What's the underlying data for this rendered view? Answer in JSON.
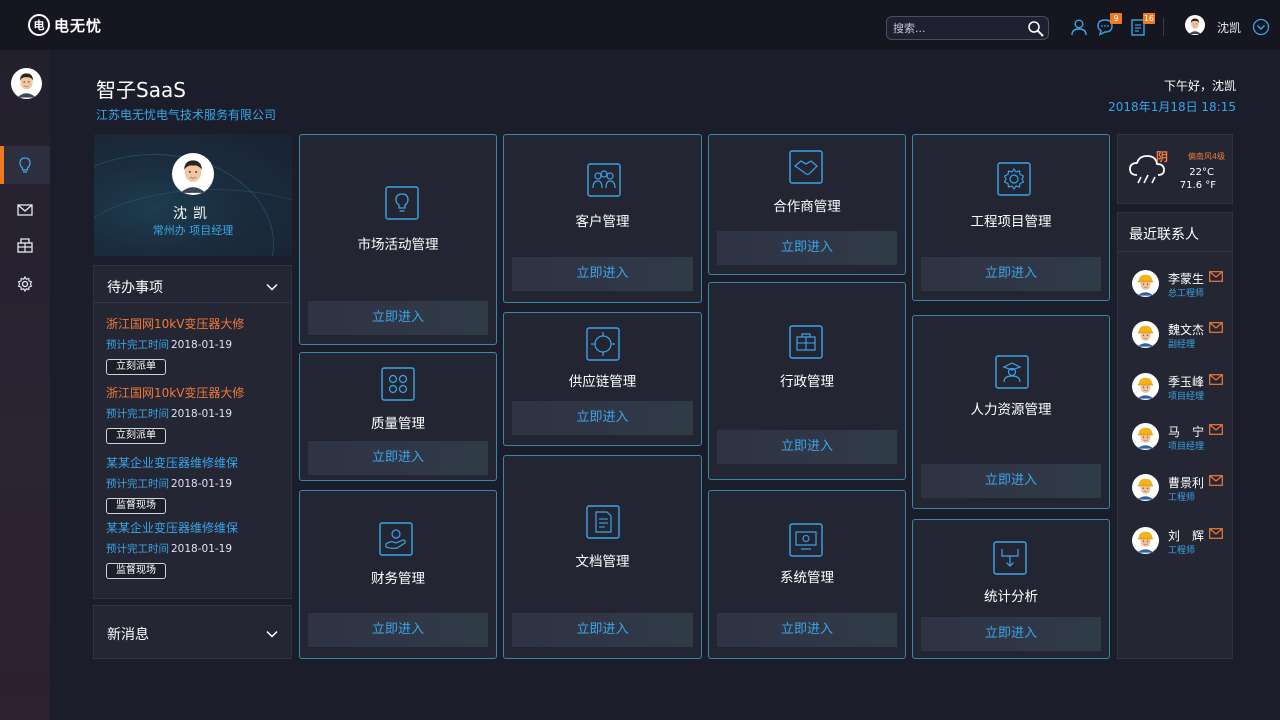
{
  "topbar": {
    "logo_text": "电无忧",
    "search_placeholder": "搜索...",
    "messages_badge": "9",
    "tasks_badge": "16",
    "user_name": "沈凯"
  },
  "header": {
    "title": "智子SaaS",
    "company": "江苏电无忧电气技术服务有限公司",
    "greeting": "下午好，沈凯",
    "datetime": "2018年1月18日 18:15"
  },
  "profile": {
    "name": "沈凯",
    "role": "常州办 项目经理"
  },
  "todo": {
    "title": "待办事项",
    "items": [
      {
        "title": "浙江国网10kV变压器大修",
        "meta_label": "预计完工时间",
        "date": "2018-01-19",
        "action": "立刻派单"
      },
      {
        "title": "浙江国网10kV变压器大修",
        "meta_label": "预计完工时间",
        "date": "2018-01-19",
        "action": "立刻派单"
      },
      {
        "title": "某某企业变压器维修维保",
        "meta_label": "预计完工时间",
        "date": "2018-01-19",
        "action": "监督现场"
      },
      {
        "title": "某某企业变压器维修维保",
        "meta_label": "预计完工时间",
        "date": "2018-01-19",
        "action": "监督现场"
      }
    ]
  },
  "news": {
    "title": "新消息"
  },
  "modules": {
    "enter_label": "立即进入",
    "market": "市场活动管理",
    "quality": "质量管理",
    "finance": "财务管理",
    "customer": "客户管理",
    "supply": "供应链管理",
    "document": "文档管理",
    "partner": "合作商管理",
    "admin": "行政管理",
    "system": "系统管理",
    "project": "工程项目管理",
    "hr": "人力资源管理",
    "stats": "统计分析"
  },
  "weather": {
    "condition": "阴",
    "wind": "偏南风4级",
    "temp_c": "22°C",
    "temp_f": "71.6 °F"
  },
  "contacts": {
    "title": "最近联系人",
    "list": [
      {
        "name": "李蒙生",
        "role": "总工程师"
      },
      {
        "name": "魏文杰",
        "role": "副经理"
      },
      {
        "name": "季玉峰",
        "role": "项目经理"
      },
      {
        "name": "马　宁",
        "role": "项目经理"
      },
      {
        "name": "曹景利",
        "role": "工程师"
      },
      {
        "name": "刘　辉",
        "role": "工程师"
      }
    ]
  },
  "colors": {
    "accent_blue": "#3aa6e8",
    "accent_orange": "#f07a20",
    "card_border": "#3a86a8"
  }
}
